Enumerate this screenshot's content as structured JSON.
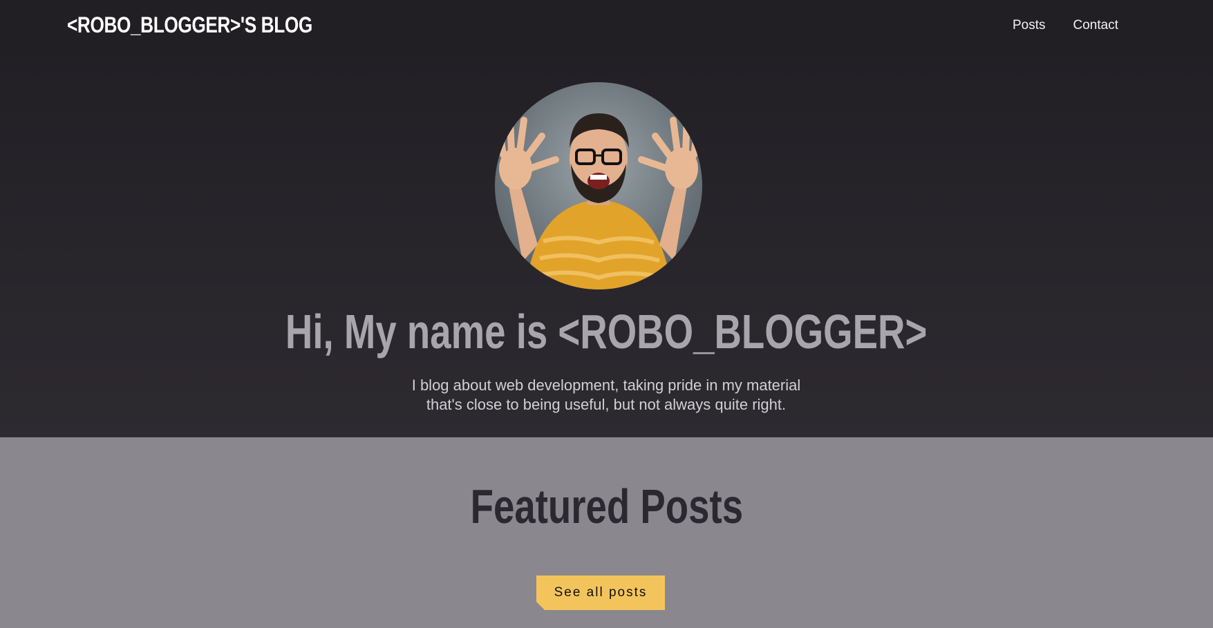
{
  "header": {
    "logo": "<ROBO_BLOGGER>'S BLOG",
    "nav": [
      {
        "label": "Posts"
      },
      {
        "label": "Contact"
      }
    ]
  },
  "hero": {
    "title": "Hi, My name is <ROBO_BLOGGER>",
    "subtitle_line1": "I blog about web development, taking pride in my material",
    "subtitle_line2": "that's close to being useful, but not always quite right."
  },
  "featured": {
    "title": "Featured Posts",
    "button_label": "See all posts"
  },
  "colors": {
    "header_bg": "#221f24",
    "section_bg": "#8a878f",
    "button_bg": "#f4c45c",
    "button_accent": "#3ce3e6"
  }
}
